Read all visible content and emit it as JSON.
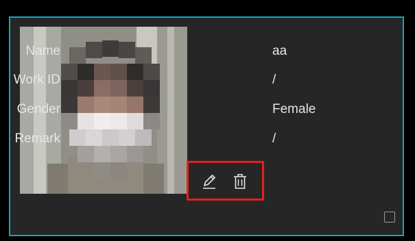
{
  "person": {
    "fields": [
      {
        "label": "Name",
        "value": "aa"
      },
      {
        "label": "Work ID",
        "value": "/"
      },
      {
        "label": "Gender",
        "value": "Female"
      },
      {
        "label": "Remark",
        "value": "/"
      }
    ]
  },
  "actions": {
    "edit_icon": "pencil-icon",
    "delete_icon": "trash-icon"
  },
  "colors": {
    "card_background": "#262626",
    "card_border": "#1aa3c4",
    "highlight": "#e4221b",
    "text": "#e6e6e6"
  }
}
